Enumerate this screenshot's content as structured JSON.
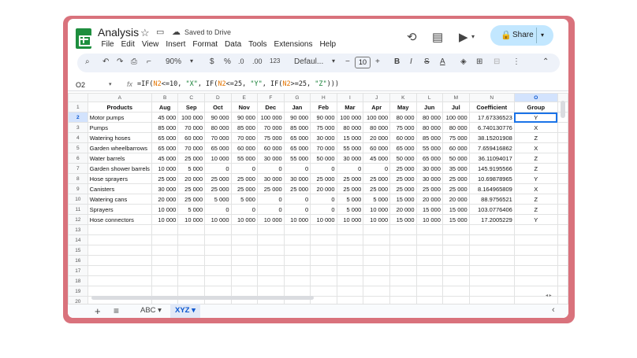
{
  "doc": {
    "title": "Analysis",
    "saved_status": "Saved to Drive"
  },
  "menu": [
    "File",
    "Edit",
    "View",
    "Insert",
    "Format",
    "Data",
    "Tools",
    "Extensions",
    "Help"
  ],
  "share": {
    "label": "Share"
  },
  "toolbar": {
    "zoom": "90%",
    "currency": "$",
    "percent": "%",
    "dec_decrease": ".0",
    "dec_increase": ".00",
    "number_format": "123",
    "font": "Defaul...",
    "font_size": "10",
    "bold": "B",
    "italic": "I",
    "text_color": "A"
  },
  "formula_bar": {
    "cell_ref": "O2",
    "fx": "fx"
  },
  "columns": [
    "A",
    "B",
    "C",
    "D",
    "E",
    "F",
    "G",
    "H",
    "I",
    "J",
    "K",
    "L",
    "M",
    "N",
    "O"
  ],
  "headers": [
    "Products",
    "Aug",
    "Sep",
    "Oct",
    "Nov",
    "Dec",
    "Jan",
    "Feb",
    "Mar",
    "Apr",
    "May",
    "Jun",
    "Jul",
    "Coefficient",
    "Group"
  ],
  "rows": [
    [
      "Motor pumps",
      "45 000",
      "100 000",
      "90 000",
      "90 000",
      "100 000",
      "90 000",
      "90 000",
      "100 000",
      "100 000",
      "80 000",
      "80 000",
      "100 000",
      "17.67336523",
      "Y"
    ],
    [
      "Pumps",
      "85 000",
      "70 000",
      "80 000",
      "85 000",
      "70 000",
      "85 000",
      "75 000",
      "80 000",
      "80 000",
      "75 000",
      "80 000",
      "80 000",
      "6.740130776",
      "X"
    ],
    [
      "Watering hoses",
      "65 000",
      "60 000",
      "70 000",
      "70 000",
      "75 000",
      "65 000",
      "30 000",
      "15 000",
      "20 000",
      "60 000",
      "85 000",
      "75 000",
      "38.15201908",
      "Z"
    ],
    [
      "Garden wheelbarrows",
      "65 000",
      "70 000",
      "65 000",
      "60 000",
      "60 000",
      "65 000",
      "70 000",
      "55 000",
      "60 000",
      "65 000",
      "55 000",
      "60 000",
      "7.659416862",
      "X"
    ],
    [
      "Water barrels",
      "45 000",
      "25 000",
      "10 000",
      "55 000",
      "30 000",
      "55 000",
      "50 000",
      "30 000",
      "45 000",
      "50 000",
      "65 000",
      "50 000",
      "36.11094017",
      "Z"
    ],
    [
      "Garden shower barrels",
      "10 000",
      "5 000",
      "0",
      "0",
      "0",
      "0",
      "0",
      "0",
      "0",
      "25 000",
      "30 000",
      "35 000",
      "145.9195566",
      "Z"
    ],
    [
      "Hose sprayers",
      "25 000",
      "20 000",
      "25 000",
      "25 000",
      "30 000",
      "30 000",
      "25 000",
      "25 000",
      "25 000",
      "25 000",
      "30 000",
      "25 000",
      "10.69878965",
      "Y"
    ],
    [
      "Canisters",
      "30 000",
      "25 000",
      "25 000",
      "25 000",
      "25 000",
      "25 000",
      "20 000",
      "25 000",
      "25 000",
      "25 000",
      "25 000",
      "25 000",
      "8.164965809",
      "X"
    ],
    [
      "Watering cans",
      "20 000",
      "25 000",
      "5 000",
      "5 000",
      "0",
      "0",
      "0",
      "5 000",
      "5 000",
      "15 000",
      "20 000",
      "20 000",
      "88.9756521",
      "Z"
    ],
    [
      "Sprayers",
      "10 000",
      "5 000",
      "0",
      "0",
      "0",
      "0",
      "0",
      "5 000",
      "10 000",
      "20 000",
      "15 000",
      "15 000",
      "103.0776406",
      "Z"
    ],
    [
      "Hose connectors",
      "10 000",
      "10 000",
      "10 000",
      "10 000",
      "10 000",
      "10 000",
      "10 000",
      "10 000",
      "10 000",
      "15 000",
      "10 000",
      "15 000",
      "17.2005229",
      "Y"
    ]
  ],
  "row_numbers": [
    "1",
    "2",
    "3",
    "4",
    "5",
    "6",
    "7",
    "8",
    "9",
    "10",
    "11",
    "12",
    "13",
    "14",
    "15",
    "16",
    "17",
    "18",
    "19",
    "20"
  ],
  "sheets": [
    {
      "label": "ABC",
      "active": false
    },
    {
      "label": "XYZ",
      "active": true
    }
  ],
  "colors": {
    "accent": "#1a73e8",
    "sheet_green": "#1e8e3e",
    "share_bg": "#c2e7ff",
    "frame": "#d9727c"
  }
}
